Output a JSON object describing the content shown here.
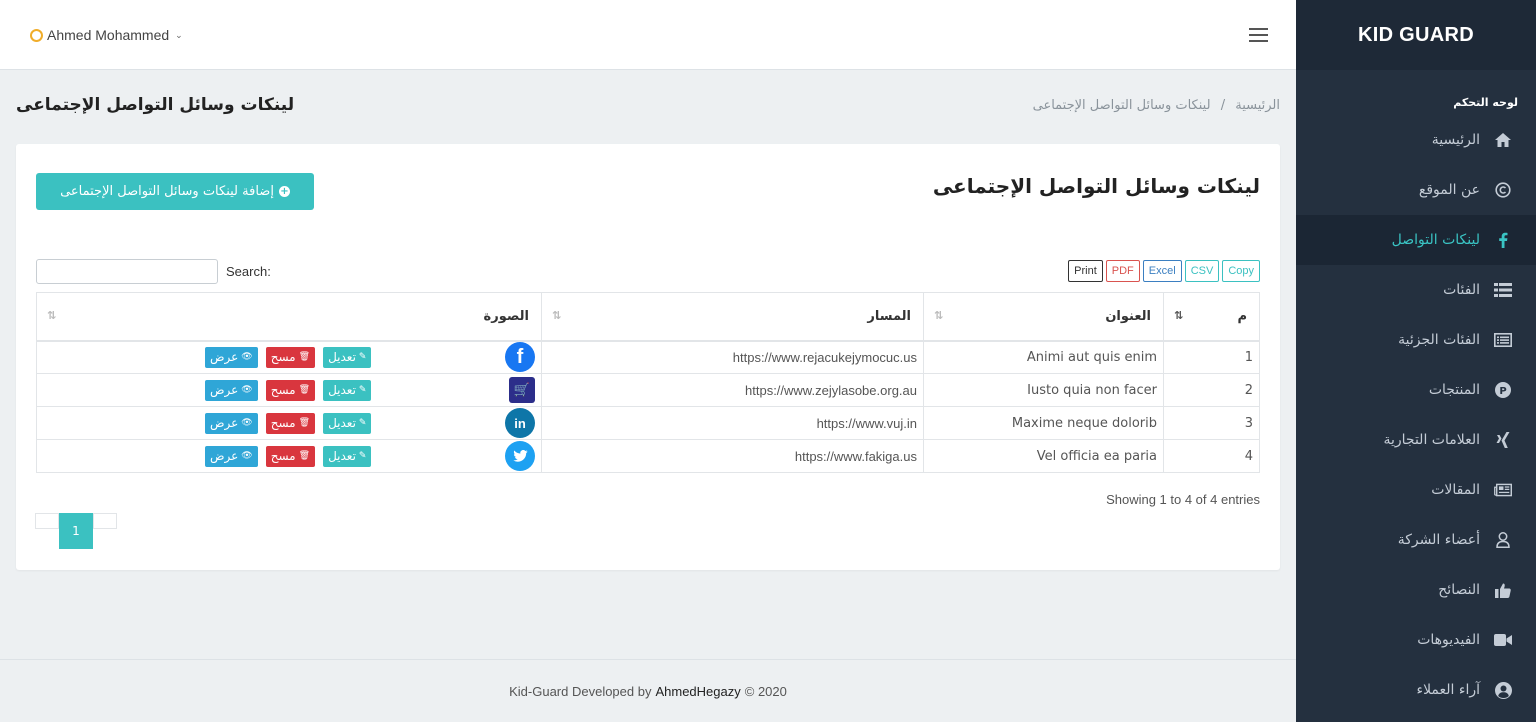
{
  "app": {
    "brand": "KID GUARD"
  },
  "topbar": {
    "user_name": "Ahmed Mohammed"
  },
  "sidebar": {
    "heading": "لوحه التحكم",
    "items": [
      {
        "label": "الرئيسية",
        "icon": "home-icon"
      },
      {
        "label": "عن الموقع",
        "icon": "copyright-icon"
      },
      {
        "label": "لينكات التواصل",
        "icon": "facebook-icon",
        "active": true
      },
      {
        "label": "الفئات",
        "icon": "list-icon"
      },
      {
        "label": "الفئات الجزئية",
        "icon": "list-alt-icon"
      },
      {
        "label": "المنتجات",
        "icon": "product-icon"
      },
      {
        "label": "العلامات التجارية",
        "icon": "xing-icon"
      },
      {
        "label": "المقالات",
        "icon": "newspaper-icon"
      },
      {
        "label": "أعضاء الشركة",
        "icon": "user-icon"
      },
      {
        "label": "النصائح",
        "icon": "thumbs-up-icon"
      },
      {
        "label": "الفيديوهات",
        "icon": "video-icon"
      },
      {
        "label": "آراء العملاء",
        "icon": "user-circle-icon"
      }
    ]
  },
  "page": {
    "title": "لينكات وسائل التواصل الإجتماعى",
    "breadcrumb": {
      "home": "الرئيسية",
      "sep": "/",
      "current": "لينكات وسائل التواصل الإجتماعى"
    }
  },
  "card": {
    "title": "لينكات وسائل التواصل الإجتماعى",
    "add_button": "إضافة لينكات وسائل التواصل الإجتماعى",
    "search_label": "Search:",
    "search_value": "",
    "export": {
      "copy": "Copy",
      "csv": "CSV",
      "excel": "Excel",
      "pdf": "PDF",
      "print": "Print"
    }
  },
  "table": {
    "columns": {
      "num": "م",
      "title": "العنوان",
      "path": "المسار",
      "image": "الصورة"
    },
    "actions": {
      "edit": "تعديل",
      "delete": "مسح",
      "view": "عرض"
    },
    "rows": [
      {
        "num": "1",
        "title": "Animi aut quis enim",
        "path": "https://www.rejacukejymocuc.us",
        "logo": "facebook-logo"
      },
      {
        "num": "2",
        "title": "Iusto quia non facer",
        "path": "https://www.zejylasobe.org.au",
        "logo": "shop-logo"
      },
      {
        "num": "3",
        "title": "Maxime neque dolorib",
        "path": "https://www.vuj.in",
        "logo": "linkedin-logo"
      },
      {
        "num": "4",
        "title": "Vel officia ea paria",
        "path": "https://www.fakiga.us",
        "logo": "twitter-logo"
      }
    ],
    "info": "Showing 1 to 4 of 4 entries",
    "current_page": "1"
  },
  "footer": {
    "prefix": "Kid-Guard Developed by",
    "author": "AhmedHegazy",
    "suffix": "© 2020"
  }
}
